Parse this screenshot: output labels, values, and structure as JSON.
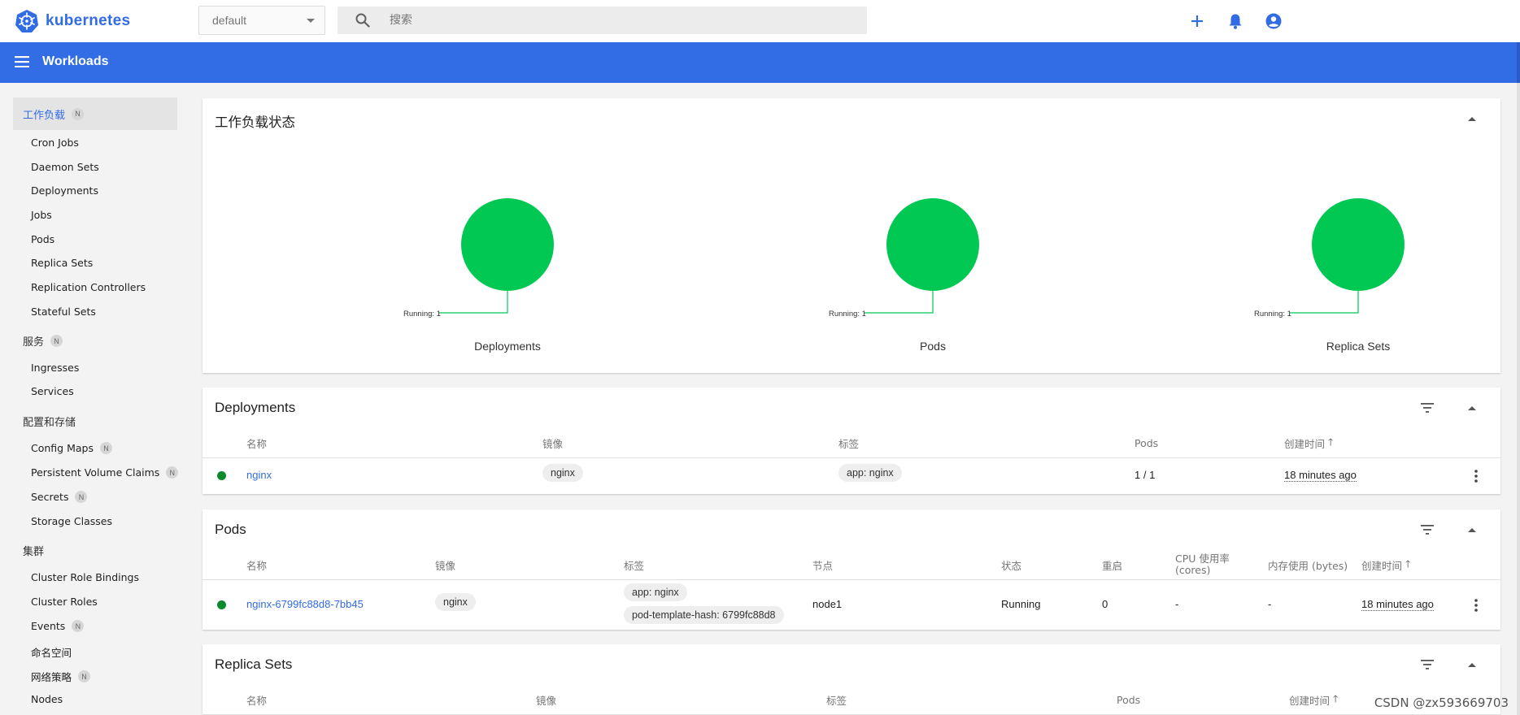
{
  "brand": {
    "name": "kubernetes",
    "color": "#326ce5"
  },
  "namespace": {
    "selected": "default"
  },
  "search": {
    "placeholder": "搜索"
  },
  "top_actions": [
    {
      "icon": "plus-icon"
    },
    {
      "icon": "bell-icon"
    },
    {
      "icon": "account-circle-icon"
    }
  ],
  "header": {
    "title": "Workloads",
    "color": "#326de6"
  },
  "sidebar": {
    "sections": [
      {
        "label": "工作负载",
        "badge": "N",
        "active": true,
        "items": [
          "Cron Jobs",
          "Daemon Sets",
          "Deployments",
          "Jobs",
          "Pods",
          "Replica Sets",
          "Replication Controllers",
          "Stateful Sets"
        ]
      },
      {
        "label": "服务",
        "badge": "N",
        "items": [
          "Ingresses",
          "Services"
        ]
      },
      {
        "label": "配置和存储",
        "badge": "",
        "items": [
          "Config Maps",
          "Persistent Volume Claims",
          "Secrets",
          "Storage Classes"
        ]
      },
      {
        "label": "集群",
        "badge": "",
        "items": [
          "Cluster Role Bindings",
          "Cluster Roles",
          "Events",
          "命名空间",
          "网络策略",
          "Nodes"
        ]
      }
    ],
    "item_badges": {
      "Config Maps": "N",
      "Persistent Volume Claims": "N",
      "Secrets": "N",
      "Events": "N",
      "网络策略": "N"
    }
  },
  "status_card": {
    "title": "工作负载状态",
    "charts": [
      {
        "name": "Deployments",
        "running_label": "Running: 1"
      },
      {
        "name": "Pods",
        "running_label": "Running: 1"
      },
      {
        "name": "Replica Sets",
        "running_label": "Running: 1"
      }
    ],
    "running_color": "#00c853"
  },
  "deployments_card": {
    "title": "Deployments",
    "columns": [
      "名称",
      "镜像",
      "标签",
      "Pods",
      "创建时间"
    ],
    "rows": [
      {
        "name": "nginx",
        "image": "nginx",
        "labels": [
          "app: nginx"
        ],
        "pods": "1 / 1",
        "created": "18 minutes ago"
      }
    ]
  },
  "pods_card": {
    "title": "Pods",
    "columns": [
      "名称",
      "镜像",
      "标签",
      "节点",
      "状态",
      "重启",
      "CPU 使用率 (cores)",
      "内存使用 (bytes)",
      "创建时间"
    ],
    "rows": [
      {
        "name": "nginx-6799fc88d8-7bb45",
        "image": "nginx",
        "labels": [
          "app: nginx",
          "pod-template-hash: 6799fc88d8"
        ],
        "node": "node1",
        "status": "Running",
        "restarts": "0",
        "cpu": "-",
        "memory": "-",
        "created": "18 minutes ago"
      }
    ]
  },
  "replicasets_card": {
    "title": "Replica Sets",
    "columns": [
      "名称",
      "镜像",
      "标签",
      "Pods",
      "创建时间"
    ]
  },
  "status_color_ok": "#0a8a2c",
  "watermark": "CSDN @zx593669703"
}
